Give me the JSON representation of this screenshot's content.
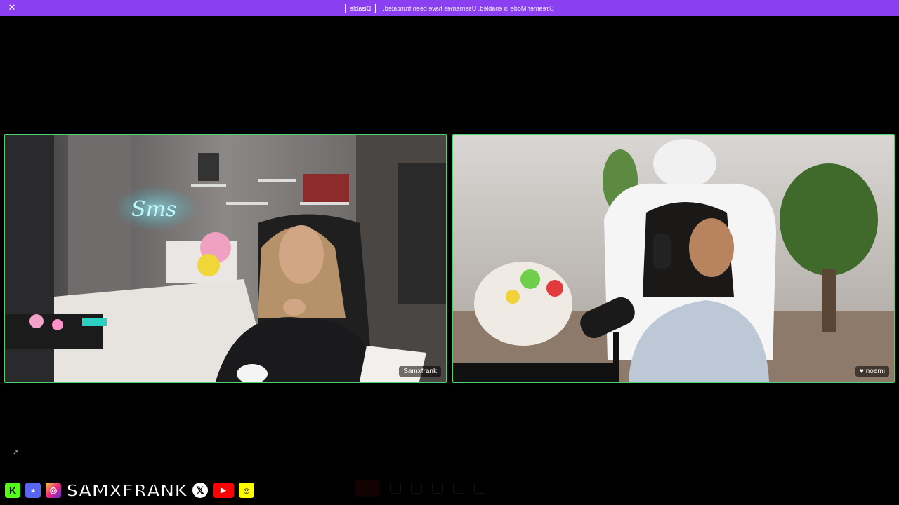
{
  "banner": {
    "message": "Streamer Mode is enabled. Usernames have been truncated.",
    "disable_label": "Disable",
    "close_icon": "close-icon",
    "color": "#8a3ff0"
  },
  "participants": [
    {
      "name": "Samxfrank"
    },
    {
      "name": "noemi",
      "badge_icon": "heart-icon"
    }
  ],
  "social": {
    "handle": "SAMXFRANK",
    "icons": [
      "kick-icon",
      "discord-icon",
      "instagram-icon",
      "x-icon",
      "youtube-icon",
      "snapchat-icon"
    ]
  },
  "tile_border_color": "#4cd36b"
}
